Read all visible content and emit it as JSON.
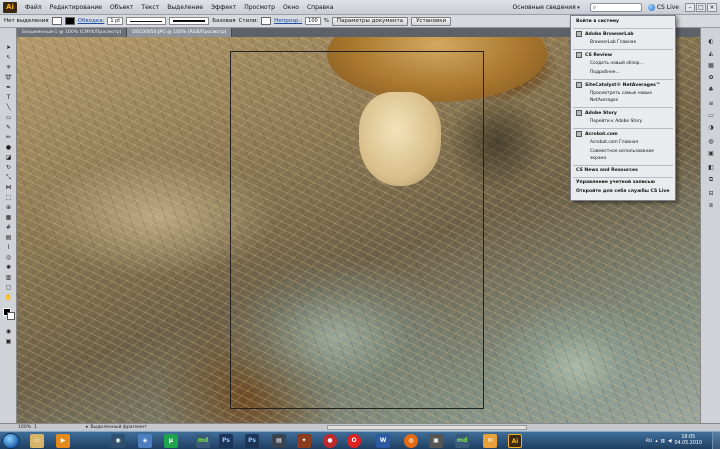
{
  "menubar": {
    "logo": "Ai",
    "items": [
      "Файл",
      "Редактирование",
      "Объект",
      "Текст",
      "Выделение",
      "Эффект",
      "Просмотр",
      "Окно",
      "Справка"
    ],
    "workspace": "Основные сведения",
    "cs_live": "CS Live"
  },
  "controlbar": {
    "selection_label": "Нет выделения",
    "stroke_label": "Обводка:",
    "stroke_weight": "1 pt",
    "brush_label": "Базовая",
    "styles_label": "Стили:",
    "opacity_label": "Непрозр.:",
    "opacity_value": "100",
    "opacity_unit": "%",
    "doc_settings_button": "Параметры документа",
    "settings_button": "Установки"
  },
  "tabs": [
    "Безымянный-1 @ 100% (CMYK/Просмотр)",
    "DSC00050.JPG @ 100% (RGB/Просмотр)"
  ],
  "dropdown": {
    "sign_in": "Войти в систему",
    "browserlab": "Adobe BrowserLab",
    "browserlab_home": "BrowserLab Главная",
    "cs_review": "CS Review",
    "create_review": "Создать новый обзор...",
    "more": "Подробнее...",
    "sitecatalyst": "SiteCatalyst® NetAverages™",
    "view_netaverages_1": "Просмотреть самые новые",
    "view_netaverages_2": "NetAverages",
    "adobe_story": "Adobe Story",
    "go_story": "Перейти к Adobe Story",
    "acrobat": "Acrobat.com",
    "acrobat_home": "Acrobat.com Главная",
    "screen_share_1": "Совместное использование",
    "screen_share_2": "экрана",
    "news": "CS News and Resources",
    "account": "Управление учетной записью",
    "discover": "Откройте для себя службы CS Live"
  },
  "statusbar": {
    "zoom": "100%",
    "page": "1",
    "info": "Выделенный фрагмент"
  },
  "taskbar": {
    "lang": "RU",
    "time": "18:05",
    "date": "04.05.2010"
  }
}
